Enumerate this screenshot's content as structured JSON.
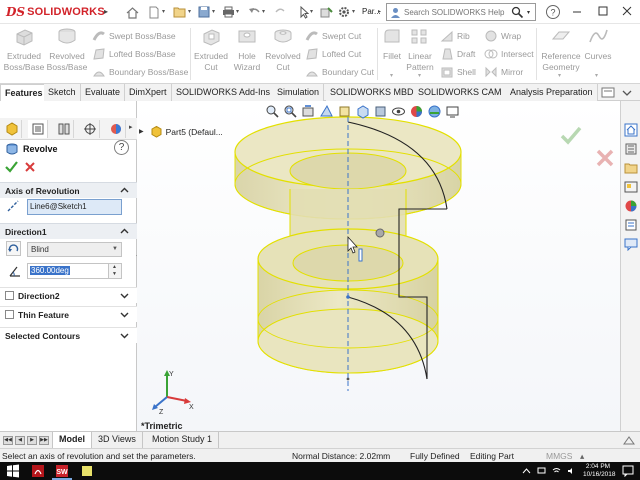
{
  "app": {
    "brand_ds": "DS",
    "brand_name": "SOLIDWORKS",
    "document_title": "Par...",
    "search_placeholder": "Search SOLIDWORKS Help"
  },
  "ribbon": {
    "big_buttons": [
      {
        "id": "extruded-boss",
        "line1": "Extruded",
        "line2": "Boss/Base"
      },
      {
        "id": "revolved-boss",
        "line1": "Revolved",
        "line2": "Boss/Base"
      },
      {
        "id": "extruded-cut",
        "line1": "Extruded",
        "line2": "Cut"
      },
      {
        "id": "hole-wizard",
        "line1": "Hole",
        "line2": "Wizard"
      },
      {
        "id": "revolved-cut",
        "line1": "Revolved",
        "line2": "Cut"
      },
      {
        "id": "fillet",
        "line1": "Fillet",
        "line2": ""
      },
      {
        "id": "linear-pattern",
        "line1": "Linear",
        "line2": "Pattern"
      },
      {
        "id": "reference-geometry",
        "line1": "Reference",
        "line2": "Geometry"
      },
      {
        "id": "curves",
        "line1": "Curves",
        "line2": ""
      }
    ],
    "small_buttons": {
      "swept_boss": "Swept Boss/Base",
      "lofted_boss": "Lofted Boss/Base",
      "boundary_boss": "Boundary Boss/Base",
      "swept_cut": "Swept Cut",
      "lofted_cut": "Lofted Cut",
      "boundary_cut": "Boundary Cut",
      "rib": "Rib",
      "draft": "Draft",
      "shell": "Shell",
      "wrap": "Wrap",
      "intersect": "Intersect",
      "mirror": "Mirror"
    }
  },
  "command_tabs": [
    "Features",
    "Sketch",
    "Evaluate",
    "DimXpert",
    "SOLIDWORKS Add-Ins",
    "Simulation",
    "SOLIDWORKS MBD",
    "SOLIDWORKS CAM",
    "Analysis Preparation"
  ],
  "property_manager": {
    "title": "Revolve",
    "help": "?",
    "axis_group": "Axis of Revolution",
    "axis_value": "Line6@Sketch1",
    "direction1_group": "Direction1",
    "end_condition": "Blind",
    "angle": "360.00deg",
    "direction2_label": "Direction2",
    "thin_feature_label": "Thin Feature",
    "selected_contours_label": "Selected Contours"
  },
  "graphics": {
    "tree_root": "Part5  (Defaul...",
    "view_orientation": "*Trimetric"
  },
  "bottom_tabs": [
    "Model",
    "3D Views",
    "Motion Study 1"
  ],
  "status": {
    "message": "Select an axis of revolution and set the parameters.",
    "normal_distance": "Normal Distance: 2.02mm",
    "definition": "Fully Defined",
    "mode": "Editing Part",
    "units": "MMGS"
  },
  "taskbar": {
    "time": "2:04 PM",
    "date": "10/16/2018"
  },
  "colors": {
    "brand_red": "#d2232a",
    "part_fill": "#e6e2b5",
    "part_edge": "#e3e000",
    "selection_blue": "#3a73c9",
    "ok_green": "#3aa335",
    "cancel_red": "#d83b3b"
  }
}
